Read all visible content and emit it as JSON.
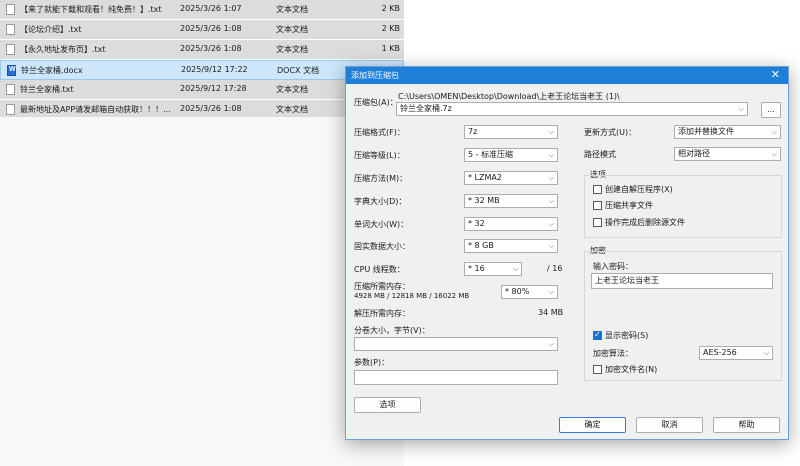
{
  "file_list": [
    {
      "name": "【来了就能下载和观看！纯免费！】.txt",
      "date": "2025/3/26 1:07",
      "type": "文本文档",
      "size": "2 KB",
      "icon": "txt-file-icon",
      "selected": false
    },
    {
      "name": "【论坛介绍】.txt",
      "date": "2025/3/26 1:08",
      "type": "文本文档",
      "size": "2 KB",
      "icon": "txt-file-icon",
      "selected": false
    },
    {
      "name": "【永久地址发布页】.txt",
      "date": "2025/3/26 1:08",
      "type": "文本文档",
      "size": "1 KB",
      "icon": "txt-file-icon",
      "selected": false
    },
    {
      "name": "铃兰全家桶.docx",
      "date": "2025/9/12 17:22",
      "type": "DOCX 文档",
      "size": "",
      "icon": "docx-file-icon",
      "selected": true
    },
    {
      "name": "铃兰全家桶.txt",
      "date": "2025/9/12 17:28",
      "type": "文本文档",
      "size": "",
      "icon": "txt-file-icon",
      "selected": false
    },
    {
      "name": "最新地址及APP请发邮箱自动获取！！！...",
      "date": "2025/3/26 1:08",
      "type": "文本文档",
      "size": "",
      "icon": "txt-file-icon",
      "selected": false
    }
  ],
  "dialog": {
    "title": "添加到压缩包",
    "close": "✕",
    "archive_label": "压缩包(A)：",
    "archive_path": "C:\\Users\\OMEN\\Desktop\\Download\\上老王论坛当老王 (1)\\",
    "archive_name": "铃兰全家桶.7z",
    "browse": "...",
    "format_label": "压缩格式(F)：",
    "format_value": "7z",
    "level_label": "压缩等级(L)：",
    "level_value": "5 - 标准压缩",
    "method_label": "压缩方法(M)：",
    "method_value": "* LZMA2",
    "dict_label": "字典大小(D)：",
    "dict_value": "* 32 MB",
    "word_label": "单词大小(W)：",
    "word_value": "* 32",
    "solid_label": "固实数据大小：",
    "solid_value": "* 8 GB",
    "threads_label": "CPU 线程数：",
    "threads_value": "* 16",
    "threads_total": "/ 16",
    "mem_comp_label": "压缩所需内存：",
    "mem_comp_value": "4928 MB / 12818 MB / 16022 MB",
    "mem_percent": "* 80%",
    "mem_decomp_label": "解压所需内存：",
    "mem_decomp_value": "34 MB",
    "split_label": "分卷大小，字节(V)：",
    "split_value": "",
    "params_label": "参数(P)：",
    "params_value": "",
    "options_btn": "选项",
    "update_label": "更新方式(U)：",
    "update_value": "添加并替换文件",
    "path_label": "路径模式",
    "path_value": "相对路径",
    "options_group": "选项",
    "opt_sfx": "创建自解压程序(X)",
    "opt_shared": "压缩共享文件",
    "opt_delete": "操作完成后删除源文件",
    "encrypt_group": "加密",
    "password_label": "输入密码：",
    "password_value": "上老王论坛当老王",
    "show_password": "显示密码(S)",
    "enc_method_label": "加密算法：",
    "enc_method_value": "AES-256",
    "enc_names": "加密文件名(N)",
    "ok": "确定",
    "cancel": "取消",
    "help": "帮助"
  }
}
